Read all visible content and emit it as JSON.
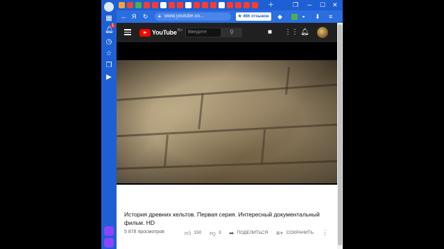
{
  "browser": {
    "url": "www.youtube.co...",
    "reviews_label": "★ 46К отзывов",
    "notification_count": "1"
  },
  "youtube": {
    "logo_text": "YouTube",
    "region": "RU",
    "search_placeholder": "Введите"
  },
  "video": {
    "title": "История древних кельтов. Первая серия. Интересный документальный фильм. HD",
    "views": "5 878 просмотров",
    "likes": "150",
    "dislikes": "3",
    "share_label": "ПОДЕЛИТЬСЯ",
    "save_label": "СОХРАНИТЬ"
  },
  "colors": {
    "browser_accent": "#1e5fd4",
    "youtube_red": "#ff0000",
    "yt_header": "#202020"
  },
  "icons": [
    "user-icon",
    "grid-icon",
    "bell-icon",
    "history-icon",
    "star-icon",
    "collections-icon",
    "play-circle-icon",
    "back-icon",
    "forward-icon",
    "reload-icon",
    "lock-icon",
    "menu-icon",
    "search-icon",
    "camera-icon",
    "apps-icon",
    "notification-icon",
    "like-icon",
    "dislike-icon",
    "share-icon",
    "save-icon",
    "more-icon"
  ]
}
